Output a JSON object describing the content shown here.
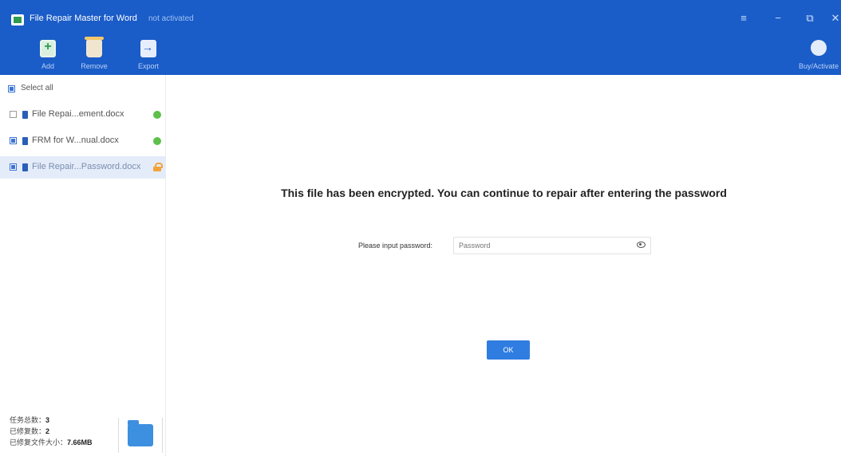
{
  "app": {
    "title": "File Repair Master for Word",
    "status": "not activated"
  },
  "window_controls": {
    "menu_icon": "≡",
    "minimize_icon": "−",
    "maximize_icon": "⧉",
    "close_icon": "✕"
  },
  "toolbar": {
    "add_label": "Add",
    "remove_label": "Remove",
    "export_label": "Export",
    "buy_label": "Buy/Activate"
  },
  "sidebar": {
    "select_all": "Select all",
    "files": [
      {
        "name": "File Repai...ement.docx",
        "checked": false,
        "status": "ok"
      },
      {
        "name": "FRM for W...nual.docx",
        "checked": true,
        "status": "ok"
      },
      {
        "name": "File Repair...Password.docx",
        "checked": true,
        "status": "locked"
      }
    ],
    "stats": {
      "total_label": "任务总数：",
      "total_value": "3",
      "repaired_label": "已修复数：",
      "repaired_value": "2",
      "size_label": "已修复文件大小：",
      "size_value": "7.66MB"
    }
  },
  "main": {
    "message": "This file has been encrypted. You can continue to repair after entering the password",
    "password_label": "Please input password:",
    "password_placeholder": "Password",
    "ok_label": "OK"
  }
}
